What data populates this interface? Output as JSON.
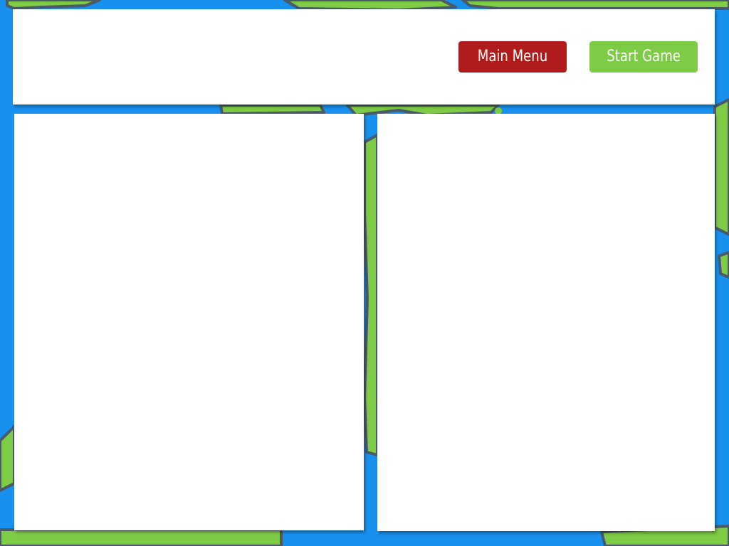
{
  "colors": {
    "water": "#1790ee",
    "land": "#7ecc45",
    "land_outline": "#4a5a66",
    "panel": "#ffffff",
    "main_menu_button": "#b01c1c",
    "start_game_button": "#7ecc45"
  },
  "toolbar": {
    "main_menu_label": "Main Menu",
    "start_game_label": "Start Game"
  },
  "icons": {
    "background": "world-map"
  }
}
